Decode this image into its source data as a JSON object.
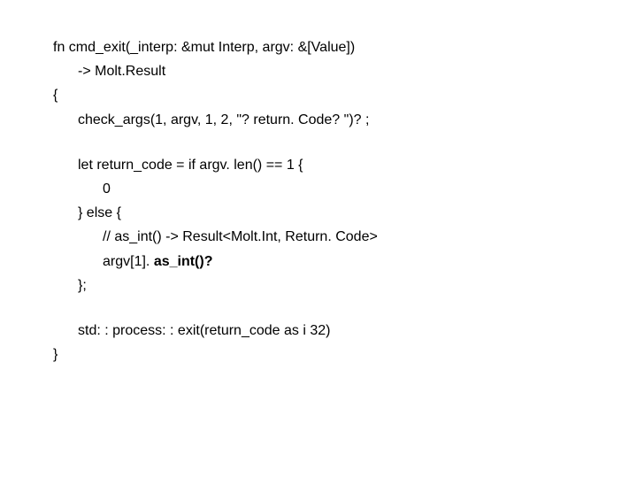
{
  "lines": {
    "l1": "fn cmd_exit(_interp: &mut Interp, argv: &[Value])",
    "l2": "-> Molt.Result",
    "l3": "{",
    "l4": "check_args(1, argv, 1, 2, \"? return. Code? \")? ;",
    "l5": "let return_code = if argv. len() == 1 {",
    "l6": "0",
    "l7": "} else {",
    "l8": "// as_int() -> Result<Molt.Int, Return. Code>",
    "l9a": "argv[1]. ",
    "l9b": "as_int()?",
    "l10": "};",
    "l11": "std: : process: : exit(return_code as i 32)",
    "l12": "}"
  }
}
